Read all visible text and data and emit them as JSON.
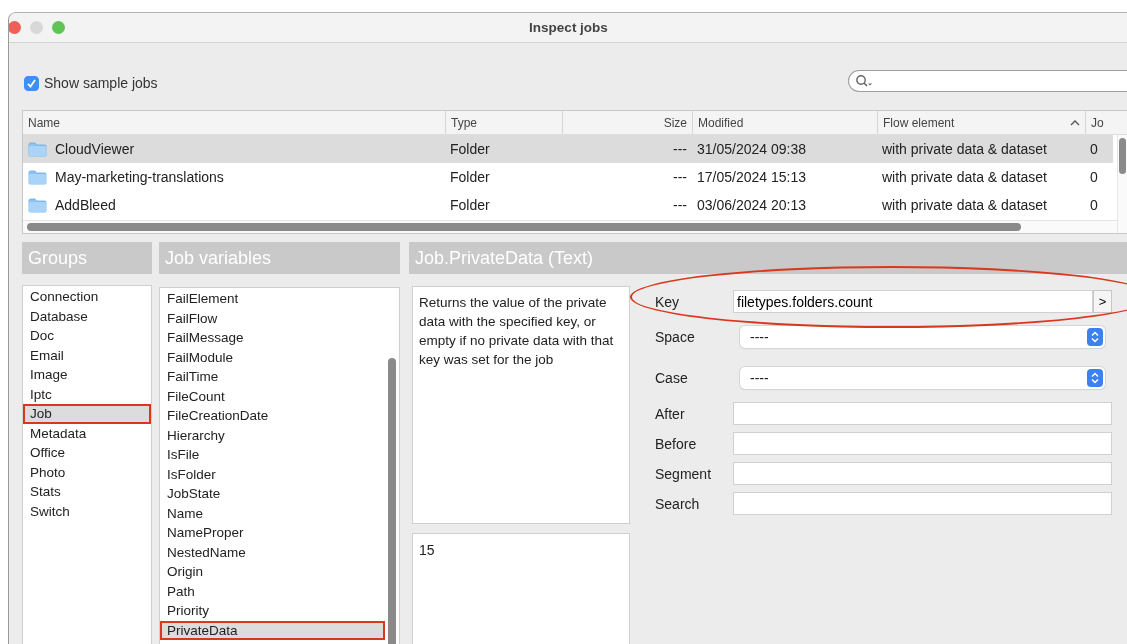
{
  "window": {
    "title": "Inspect jobs"
  },
  "show_sample_jobs": {
    "label": "Show sample jobs",
    "checked": true
  },
  "table": {
    "columns": [
      {
        "label": "Name",
        "sorted": false
      },
      {
        "label": "Type",
        "sorted": false
      },
      {
        "label": "Size",
        "sorted": false
      },
      {
        "label": "Modified",
        "sorted": false
      },
      {
        "label": "Flow element",
        "sorted": true
      },
      {
        "label": "Jo",
        "sorted": false
      }
    ],
    "rows": [
      {
        "selected": true,
        "cells": [
          "CloudViewer",
          "Folder",
          "---",
          "31/05/2024 09:38",
          "with private data & dataset",
          "0"
        ]
      },
      {
        "selected": false,
        "cells": [
          "May-marketing-translations",
          "Folder",
          "---",
          "17/05/2024 15:13",
          "with private data & dataset",
          "0"
        ]
      },
      {
        "selected": false,
        "cells": [
          "AddBleed",
          "Folder",
          "---",
          "03/06/2024 20:13",
          "with private data & dataset",
          "0"
        ]
      }
    ]
  },
  "groups": {
    "title": "Groups",
    "items": [
      {
        "label": "Connection",
        "selected": false,
        "highlighted": false
      },
      {
        "label": "Database",
        "selected": false,
        "highlighted": false
      },
      {
        "label": "Doc",
        "selected": false,
        "highlighted": false
      },
      {
        "label": "Email",
        "selected": false,
        "highlighted": false
      },
      {
        "label": "Image",
        "selected": false,
        "highlighted": false
      },
      {
        "label": "Iptc",
        "selected": false,
        "highlighted": false
      },
      {
        "label": "Job",
        "selected": true,
        "highlighted": true
      },
      {
        "label": "Metadata",
        "selected": false,
        "highlighted": false
      },
      {
        "label": "Office",
        "selected": false,
        "highlighted": false
      },
      {
        "label": "Photo",
        "selected": false,
        "highlighted": false
      },
      {
        "label": "Stats",
        "selected": false,
        "highlighted": false
      },
      {
        "label": "Switch",
        "selected": false,
        "highlighted": false
      }
    ]
  },
  "variables": {
    "title": "Job variables",
    "items": [
      {
        "label": "FailElement",
        "selected": false,
        "highlighted": false
      },
      {
        "label": "FailFlow",
        "selected": false,
        "highlighted": false
      },
      {
        "label": "FailMessage",
        "selected": false,
        "highlighted": false
      },
      {
        "label": "FailModule",
        "selected": false,
        "highlighted": false
      },
      {
        "label": "FailTime",
        "selected": false,
        "highlighted": false
      },
      {
        "label": "FileCount",
        "selected": false,
        "highlighted": false
      },
      {
        "label": "FileCreationDate",
        "selected": false,
        "highlighted": false
      },
      {
        "label": "Hierarchy",
        "selected": false,
        "highlighted": false
      },
      {
        "label": "IsFile",
        "selected": false,
        "highlighted": false
      },
      {
        "label": "IsFolder",
        "selected": false,
        "highlighted": false
      },
      {
        "label": "JobState",
        "selected": false,
        "highlighted": false
      },
      {
        "label": "Name",
        "selected": false,
        "highlighted": false
      },
      {
        "label": "NameProper",
        "selected": false,
        "highlighted": false
      },
      {
        "label": "NestedName",
        "selected": false,
        "highlighted": false
      },
      {
        "label": "Origin",
        "selected": false,
        "highlighted": false
      },
      {
        "label": "Path",
        "selected": false,
        "highlighted": false
      },
      {
        "label": "Priority",
        "selected": false,
        "highlighted": false
      },
      {
        "label": "PrivateData",
        "selected": true,
        "highlighted": true
      }
    ]
  },
  "detail": {
    "title": "Job.PrivateData (Text)",
    "description": "Returns the value of the private data with the specified key, or empty if no private data with that key was set for the job",
    "result": "15",
    "fields": [
      {
        "kind": "text-button",
        "label": "Key",
        "value": "filetypes.folders.count",
        "button": ">",
        "highlighted": true
      },
      {
        "kind": "popup",
        "label": "Space",
        "value": "----"
      },
      {
        "kind": "popup",
        "label": "Case",
        "value": "----"
      },
      {
        "kind": "text",
        "label": "After"
      },
      {
        "kind": "text",
        "label": "Before"
      },
      {
        "kind": "text",
        "label": "Segment"
      },
      {
        "kind": "text",
        "label": "Search"
      }
    ]
  }
}
